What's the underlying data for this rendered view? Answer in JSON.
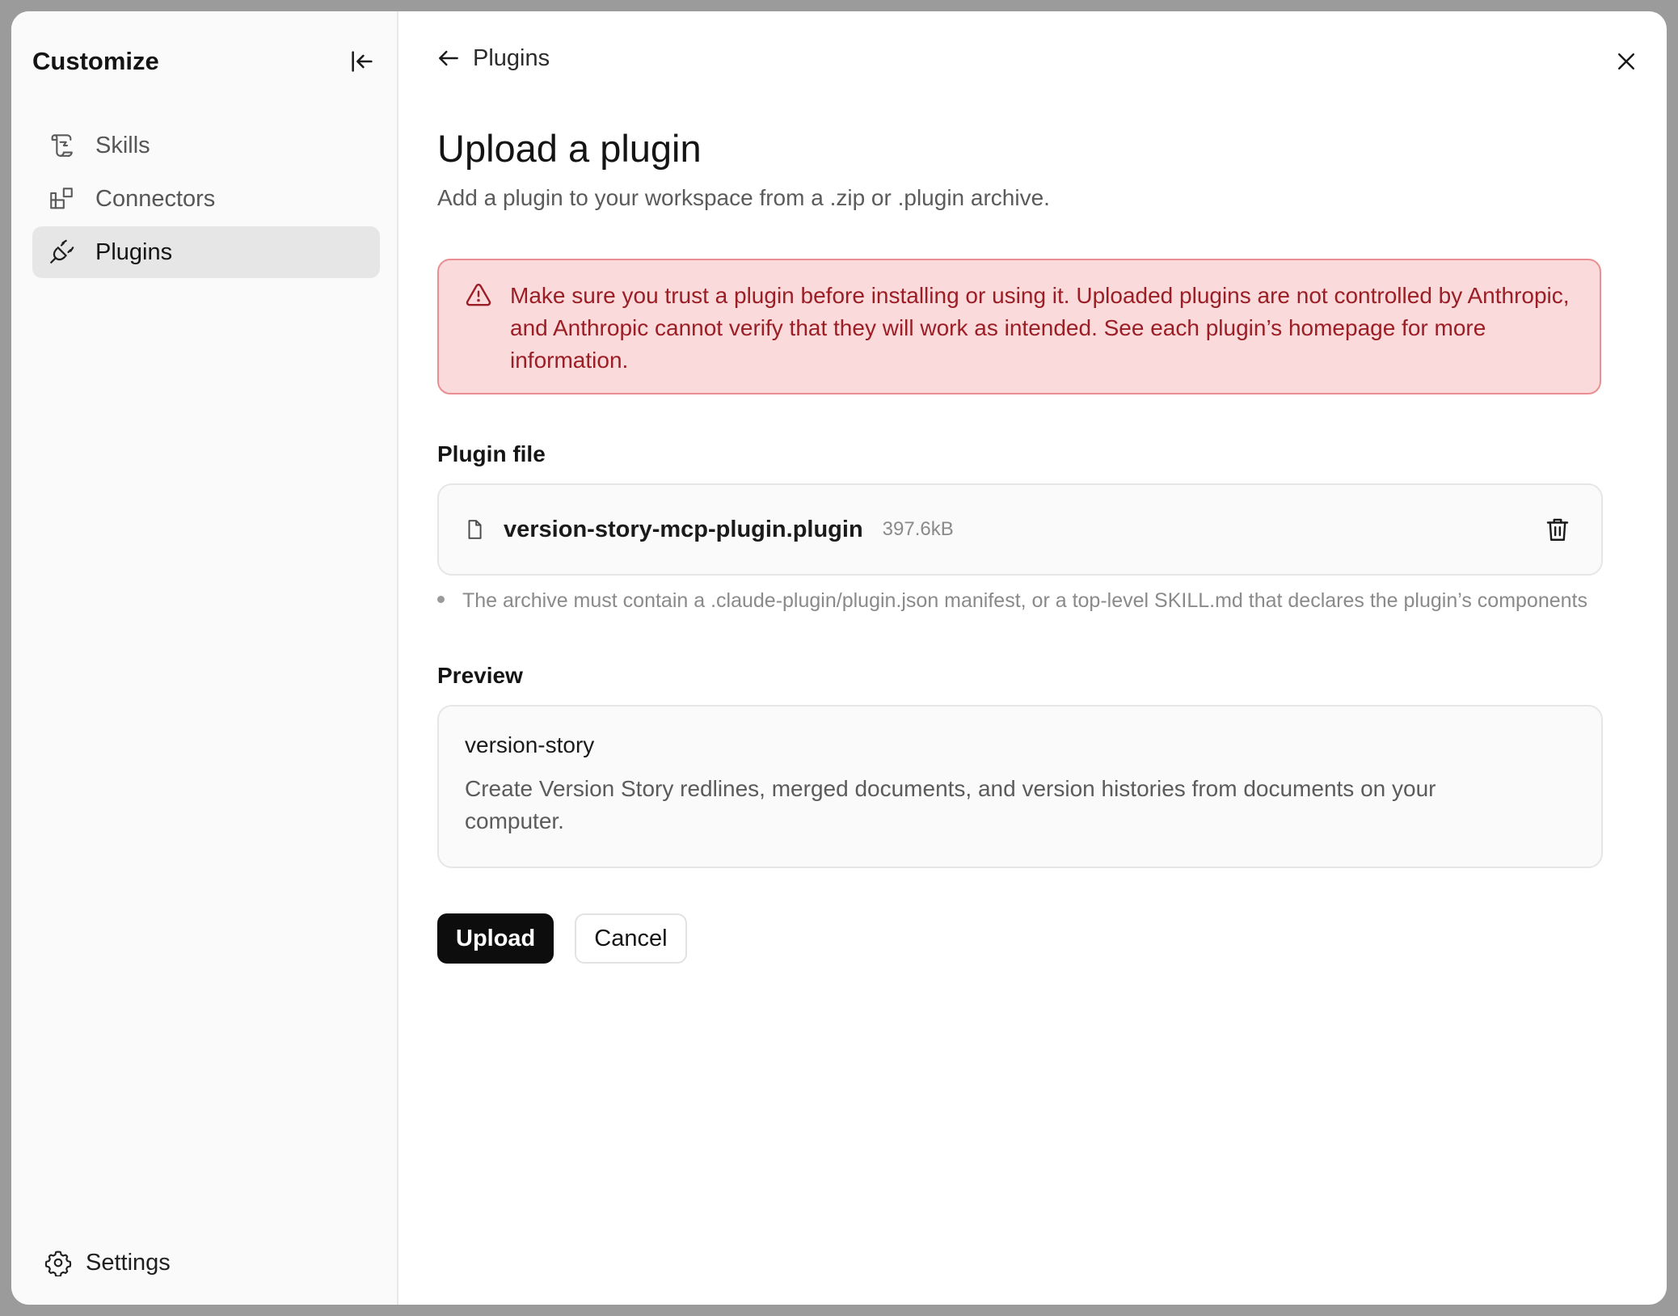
{
  "sidebar": {
    "title": "Customize",
    "items": [
      {
        "label": "Skills",
        "icon": "scroll-icon",
        "active": false
      },
      {
        "label": "Connectors",
        "icon": "connectors-icon",
        "active": false
      },
      {
        "label": "Plugins",
        "icon": "plug-icon",
        "active": true
      }
    ],
    "settings_label": "Settings"
  },
  "header": {
    "back_label": "Plugins"
  },
  "main": {
    "title": "Upload a plugin",
    "subtitle": "Add a plugin to your workspace from a .zip or .plugin archive.",
    "warning": "Make sure you trust a plugin before installing or using it. Uploaded plugins are not controlled by Anthropic, and Anthropic cannot verify that they will work as intended. See each plugin’s homepage for more information.",
    "plugin_file_label": "Plugin file",
    "file": {
      "name": "version-story-mcp-plugin.plugin",
      "size": "397.6kB"
    },
    "hint": "The archive must contain a .claude-plugin/plugin.json manifest, or a top-level SKILL.md that declares the plugin’s components",
    "preview_label": "Preview",
    "preview": {
      "name": "version-story",
      "description": "Create Version Story redlines, merged documents, and version histories from documents on your computer."
    },
    "upload_label": "Upload",
    "cancel_label": "Cancel"
  },
  "colors": {
    "warning_bg": "#fadada",
    "warning_border": "#e98f93",
    "warning_text": "#9b1e26",
    "primary_button": "#0d0d0d",
    "active_nav_bg": "#e6e6e6"
  }
}
